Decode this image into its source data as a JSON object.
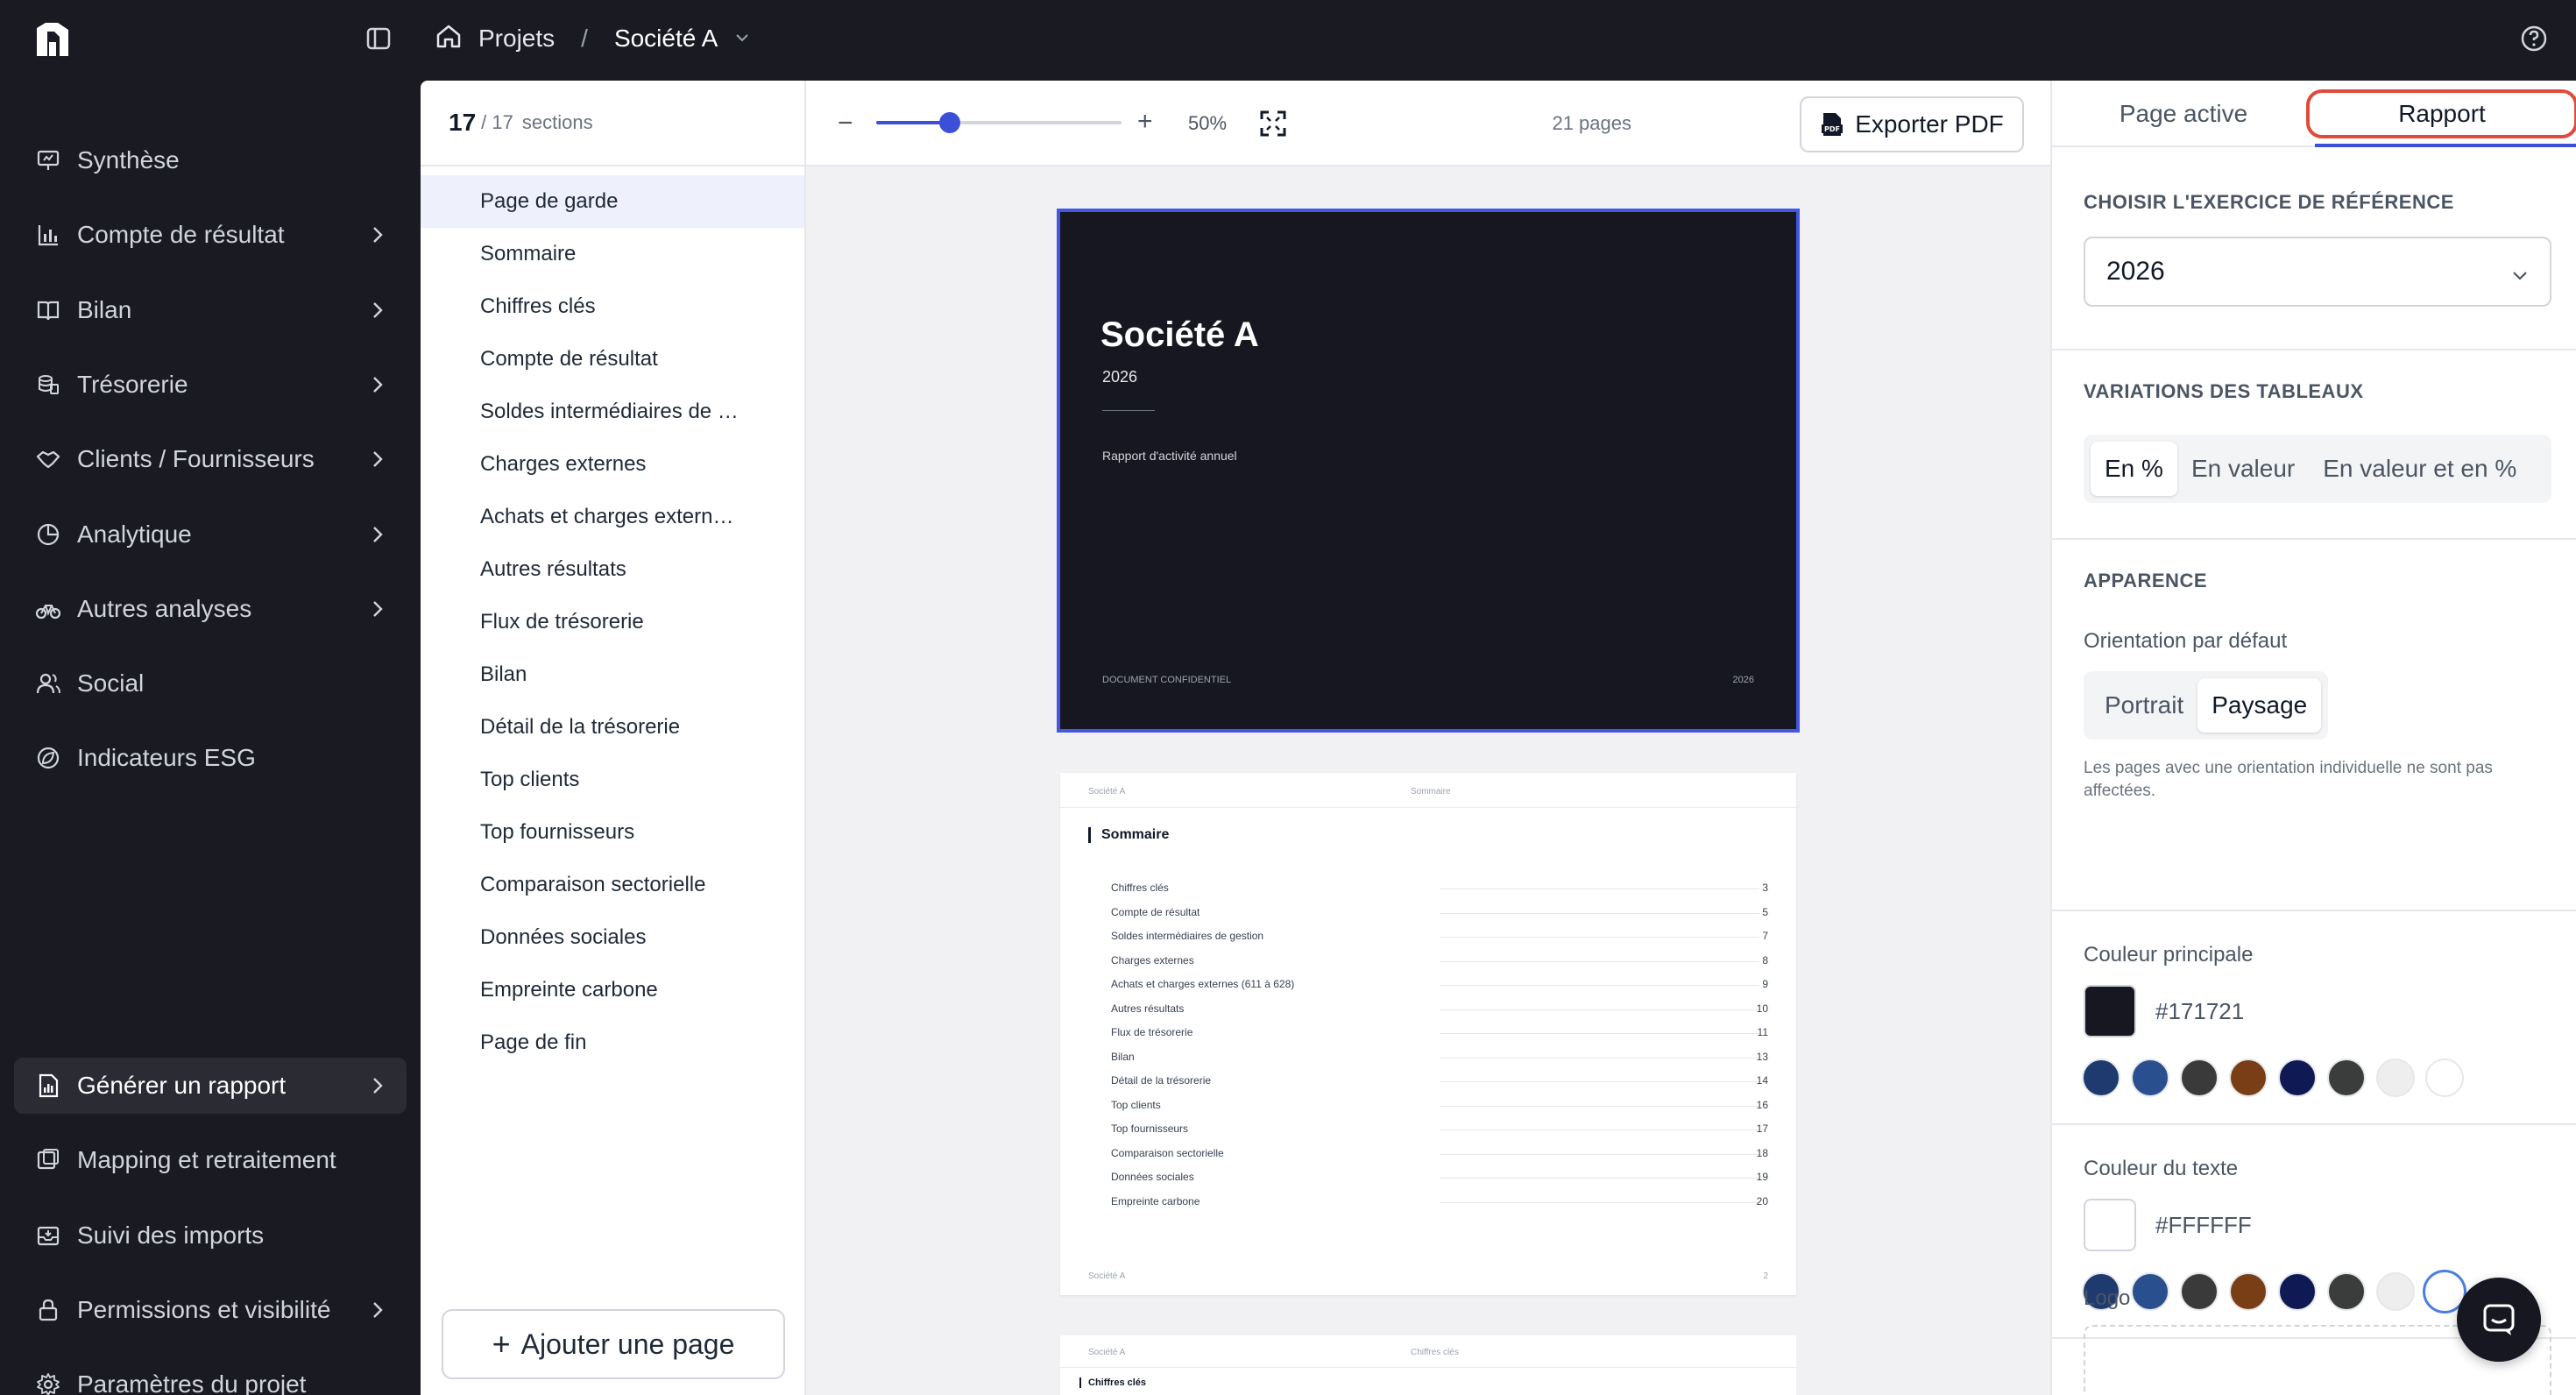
{
  "breadcrumb": {
    "home_label": "Projets",
    "separator": "/",
    "current": "Société A"
  },
  "nav": {
    "items": [
      {
        "label": "Synthèse",
        "icon": "presentation-icon",
        "has_chevron": false
      },
      {
        "label": "Compte de résultat",
        "icon": "bar-chart-icon",
        "has_chevron": true
      },
      {
        "label": "Bilan",
        "icon": "book-icon",
        "has_chevron": true
      },
      {
        "label": "Trésorerie",
        "icon": "coins-icon",
        "has_chevron": true
      },
      {
        "label": "Clients / Fournisseurs",
        "icon": "handshake-icon",
        "has_chevron": true
      },
      {
        "label": "Analytique",
        "icon": "pie-chart-icon",
        "has_chevron": true
      },
      {
        "label": "Autres analyses",
        "icon": "bike-icon",
        "has_chevron": true
      },
      {
        "label": "Social",
        "icon": "users-icon",
        "has_chevron": false
      },
      {
        "label": "Indicateurs ESG",
        "icon": "leaf-circle-icon",
        "has_chevron": false
      }
    ],
    "bottom_items": [
      {
        "label": "Générer un rapport",
        "icon": "report-icon",
        "has_chevron": true,
        "active": true
      },
      {
        "label": "Mapping et retraitement",
        "icon": "mapping-icon",
        "has_chevron": false
      },
      {
        "label": "Suivi des imports",
        "icon": "inbox-icon",
        "has_chevron": false
      },
      {
        "label": "Permissions et visibilité",
        "icon": "lock-icon",
        "has_chevron": true
      },
      {
        "label": "Paramètres du projet",
        "icon": "gear-icon",
        "has_chevron": false
      }
    ]
  },
  "sections": {
    "count": "17",
    "total": "/ 17",
    "unit": "sections",
    "items": [
      "Page de garde",
      "Sommaire",
      "Chiffres clés",
      "Compte de résultat",
      "Soldes intermédiaires de …",
      "Charges externes",
      "Achats et charges extern…",
      "Autres résultats",
      "Flux de trésorerie",
      "Bilan",
      "Détail de la trésorerie",
      "Top clients",
      "Top fournisseurs",
      "Comparaison sectorielle",
      "Données sociales",
      "Empreinte carbone",
      "Page de fin"
    ],
    "add_page_label": "Ajouter une page"
  },
  "toolbar": {
    "zoom_minus": "−",
    "zoom_plus": "+",
    "zoom_level": 0.3,
    "zoom_label": "50%",
    "pages_label": "21 pages",
    "export_label": "Exporter PDF"
  },
  "cover": {
    "title": "Société A",
    "year": "2026",
    "subtitle": "Rapport d'activité annuel",
    "confidential": "DOCUMENT CONFIDENTIEL",
    "footer_year": "2026"
  },
  "toc": {
    "header_left": "Société A",
    "header_mid": "Sommaire",
    "title": "Sommaire",
    "rows": [
      {
        "label": "Chiffres clés",
        "page": "3"
      },
      {
        "label": "Compte de résultat",
        "page": "5"
      },
      {
        "label": "Soldes intermédiaires de gestion",
        "page": "7"
      },
      {
        "label": "Charges externes",
        "page": "8"
      },
      {
        "label": "Achats et charges externes (611 à 628)",
        "page": "9"
      },
      {
        "label": "Autres résultats",
        "page": "10"
      },
      {
        "label": "Flux de trésorerie",
        "page": "11"
      },
      {
        "label": "Bilan",
        "page": "13"
      },
      {
        "label": "Détail de la trésorerie",
        "page": "14"
      },
      {
        "label": "Top clients",
        "page": "16"
      },
      {
        "label": "Top fournisseurs",
        "page": "17"
      },
      {
        "label": "Comparaison sectorielle",
        "page": "18"
      },
      {
        "label": "Données sociales",
        "page": "19"
      },
      {
        "label": "Empreinte carbone",
        "page": "20"
      }
    ],
    "footer_left": "Société A",
    "footer_right": "2"
  },
  "kpi_page": {
    "header_left": "Société A",
    "header_mid": "Chiffres clés",
    "title": "Chiffres clés"
  },
  "right_panel": {
    "tab_active_page": "Page active",
    "tab_report": "Rapport",
    "exercise_label": "CHOISIR L'EXERCICE DE RÉFÉRENCE",
    "exercise_value": "2026",
    "variations_label": "VARIATIONS DES TABLEAUX",
    "variations_options": [
      "En %",
      "En valeur",
      "En valeur et en %"
    ],
    "appearance_label": "APPARENCE",
    "orientation_label": "Orientation par défaut",
    "orientation_options": [
      "Portrait",
      "Paysage"
    ],
    "orientation_note": "Les pages avec une orientation individuelle ne sont pas affectées.",
    "main_color_label": "Couleur principale",
    "main_color": "#171721",
    "main_color_text": "#171721",
    "text_color_label": "Couleur du texte",
    "text_color": "#FFFFFF",
    "text_color_text": "#FFFFFF",
    "palette": [
      "#1e3a6e",
      "#2a4f8f",
      "#3a3a3a",
      "#7a3e17",
      "#0f1a55",
      "#3b3d3d",
      "#eeeeee",
      "#ffffff"
    ],
    "logo_label": "Logo"
  }
}
